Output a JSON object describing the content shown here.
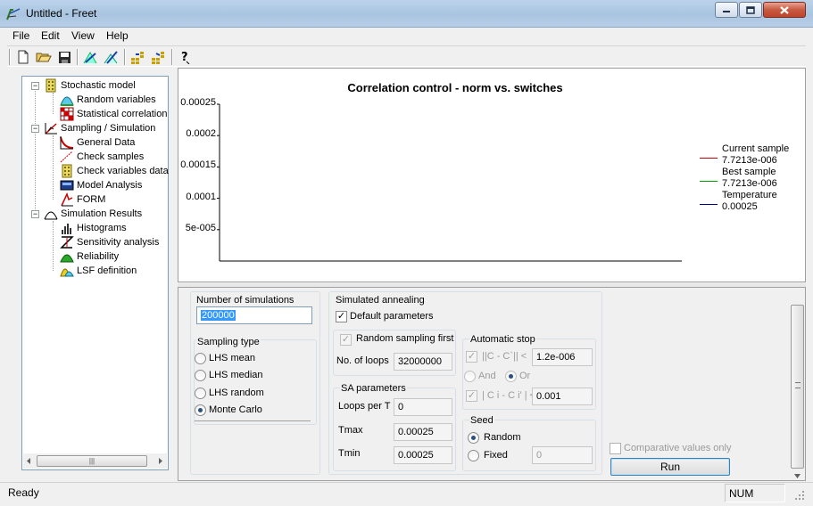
{
  "window": {
    "title": "Untitled - Freet"
  },
  "menu": {
    "file": "File",
    "edit": "Edit",
    "view": "View",
    "help": "Help"
  },
  "toolbar": {
    "icons": [
      "new-file-icon",
      "open-folder-icon",
      "save-icon",
      "run-simulation-icon",
      "run-simulation-2-icon",
      "grid-forward-icon",
      "grid-back-icon",
      "help-icon"
    ]
  },
  "tree": {
    "stochastic_model": "Stochastic model",
    "random_variables": "Random variables",
    "statistical_correlation": "Statistical correlation",
    "sampling_simulation": "Sampling / Simulation",
    "general_data": "General Data",
    "check_samples": "Check samples",
    "check_variables_data": "Check variables data",
    "model_analysis": "Model Analysis",
    "form": "FORM",
    "simulation_results": "Simulation Results",
    "histograms": "Histograms",
    "sensitivity_analysis": "Sensitivity analysis",
    "reliability": "Reliability",
    "lsf_definition": "LSF definition"
  },
  "chart_data": {
    "type": "line",
    "title": "Correlation control - norm vs. switches",
    "y_ticks": [
      "0.00025",
      "0.0002",
      "0.00015",
      "0.0001",
      "5e-005"
    ],
    "ylim": [
      0,
      0.00025
    ],
    "series": [
      {
        "name": "Current sample",
        "value_label": "7.7213e-006",
        "color": "#c00000"
      },
      {
        "name": "Best sample",
        "value_label": "7.7213e-006",
        "color": "#00a000"
      },
      {
        "name": "Temperature",
        "value_label": "0.00025",
        "color": "#000080"
      }
    ],
    "legend_position": "right"
  },
  "controls": {
    "num_sim_label": "Number of simulations",
    "num_sim_value": "200000",
    "sampling_type_label": "Sampling type",
    "lhs_mean": "LHS mean",
    "lhs_median": "LHS median",
    "lhs_random": "LHS random",
    "monte_carlo": "Monte Carlo",
    "sampling_selected": "Monte Carlo",
    "sa_label": "Simulated annealing",
    "default_params": "Default parameters",
    "default_params_checked": true,
    "random_first": "Random sampling first",
    "random_first_checked": true,
    "no_loops_label": "No. of loops",
    "no_loops_value": "32000000",
    "auto_stop_label": "Automatic stop",
    "norm_label": "||C - C`|| <",
    "norm_value": "1.2e-006",
    "and_label": "And",
    "or_label": "Or",
    "cij_label": "| C i - C i' | <",
    "cij_value": "0.001",
    "sa_params_label": "SA parameters",
    "loops_per_t_label": "Loops per T",
    "loops_per_t_value": "0",
    "tmax_label": "Tmax",
    "tmax_value": "0.00025",
    "tmin_label": "Tmin",
    "tmin_value": "0.00025",
    "seed_label": "Seed",
    "random_label": "Random",
    "fixed_label": "Fixed",
    "fixed_value": "0",
    "seed_selected": "Random",
    "comparative_label": "Comparative values only",
    "run_label": "Run"
  },
  "status": {
    "ready": "Ready",
    "num": "NUM"
  }
}
